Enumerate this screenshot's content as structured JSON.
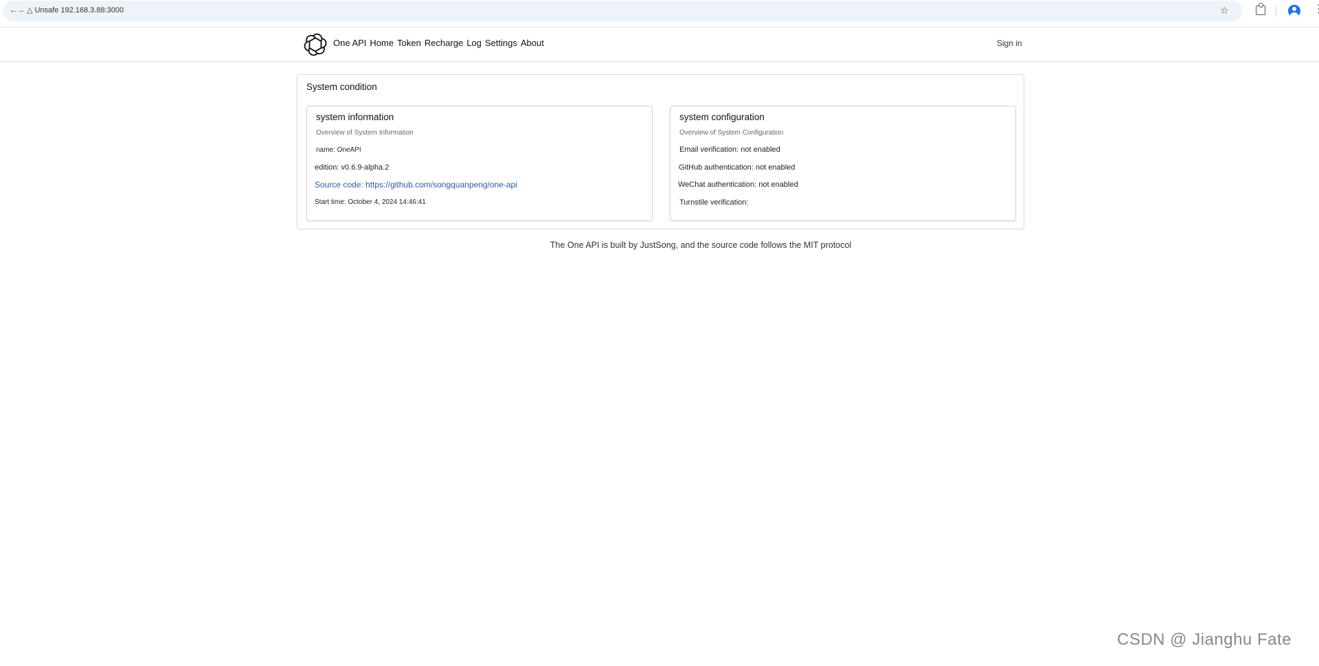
{
  "browser": {
    "back_fwd": "←→",
    "security_icon": "warning-triangle",
    "security_label": "Unsafe",
    "url": "192.168.3.88:3000"
  },
  "header": {
    "brand": "One API",
    "nav": [
      "Home",
      "Token",
      "Recharge",
      "Log",
      "Settings",
      "About"
    ],
    "signin": "Sign in"
  },
  "panel": {
    "title": "System condition",
    "system_info": {
      "title": "system information",
      "subtitle": "Overview of System Information",
      "name": "name: OneAPI",
      "edition": "edition: v0.6.9-alpha.2",
      "source": "Source code: https://github.com/songquanpeng/one-api",
      "start_time": "Start time: October 4, 2024 14:46:41"
    },
    "system_config": {
      "title": "system configuration",
      "subtitle": "Overview of System Configuration",
      "email": "Email verification: not enabled",
      "github": "GitHub authentication: not enabled",
      "wechat": "WeChat authentication: not enabled",
      "turnstile": "Turnstile verification:"
    }
  },
  "footer": "The One API is built by JustSong, and the source code follows the MIT protocol",
  "watermark": "CSDN @ Jianghu Fate",
  "colors": {
    "link": "#2c5aa0",
    "omnibox_bg": "#eef2f9",
    "profile": "#1a73e8"
  }
}
